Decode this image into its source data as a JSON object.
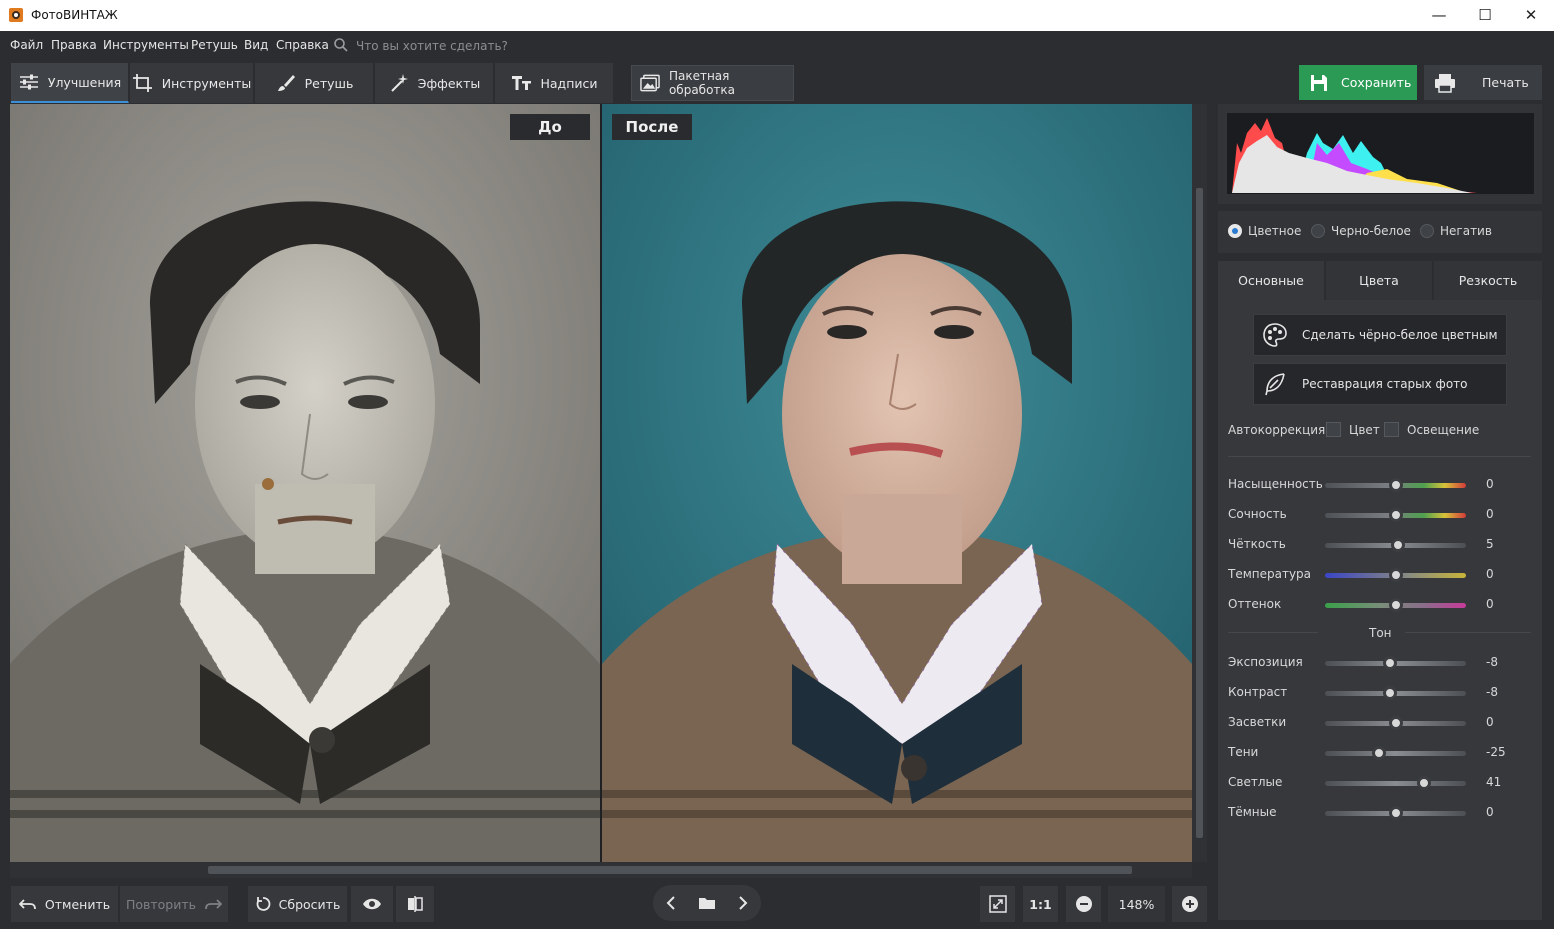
{
  "window": {
    "title": "ФотоВИНТАЖ",
    "minimize": "—",
    "maximize": "☐",
    "close": "✕"
  },
  "menu": [
    "Файл",
    "Правка",
    "Инструменты",
    "Ретушь",
    "Вид",
    "Справка"
  ],
  "search": {
    "placeholder": "Что вы хотите сделать?"
  },
  "tabs": [
    {
      "label": "Улучшения",
      "icon": "sliders-icon",
      "active": true
    },
    {
      "label": "Инструменты",
      "icon": "crop-icon",
      "active": false
    },
    {
      "label": "Ретушь",
      "icon": "brush-icon",
      "active": false
    },
    {
      "label": "Эффекты",
      "icon": "magic-wand-icon",
      "active": false
    },
    {
      "label": "Надписи",
      "icon": "text-icon",
      "active": false
    }
  ],
  "batch": {
    "label": "Пакетная обработка",
    "icon": "gallery-icon"
  },
  "actions": {
    "save": "Сохранить",
    "print": "Печать"
  },
  "compare": {
    "before": "До",
    "after": "После"
  },
  "bottom": {
    "undo": "Отменить",
    "redo": "Повторить",
    "reset": "Сбросить",
    "ratio": "1:1",
    "zoom": "148%"
  },
  "mode": {
    "options": [
      "Цветное",
      "Черно-белое",
      "Негатив"
    ],
    "selected": "Цветное"
  },
  "panel_tabs": [
    "Основные",
    "Цвета",
    "Резкость"
  ],
  "panel_active_tab": "Основные",
  "tools": {
    "colorize": "Сделать чёрно-белое цветным",
    "restore": "Реставрация старых фото"
  },
  "autocorrection": {
    "label": "Автокоррекция",
    "color": "Цвет",
    "light": "Освещение",
    "color_checked": false,
    "light_checked": false
  },
  "sliders_main": [
    {
      "label": "Насыщенность",
      "value": "0",
      "level": 0.5,
      "track": "linear-gradient(90deg,#4e5257,#7a7d82 45%,#4fa04f 70%,#d7c33a 85%,#d23a3a)"
    },
    {
      "label": "Сочность",
      "value": "0",
      "level": 0.5,
      "track": "linear-gradient(90deg,#4e5257,#7a7d82 45%,#4fa04f 70%,#d7c33a 85%,#d23a3a)"
    },
    {
      "label": "Чёткость",
      "value": "5",
      "level": 0.52,
      "track": "linear-gradient(90deg,#4c4f54,#8a8d92,#4c4f54)"
    },
    {
      "label": "Температура",
      "value": "0",
      "level": 0.5,
      "track": "linear-gradient(90deg,#3a46c8,#6a6d9a 35%,#8a8d80 60%,#c8b43a)"
    },
    {
      "label": "Оттенок",
      "value": "0",
      "level": 0.5,
      "track": "linear-gradient(90deg,#3aa04a,#7a8d7a 40%,#8a6d8a 70%,#c83a9a)"
    }
  ],
  "tone_header": "Тон",
  "sliders_tone": [
    {
      "label": "Экспозиция",
      "value": "-8",
      "level": 0.46
    },
    {
      "label": "Контраст",
      "value": "-8",
      "level": 0.46
    },
    {
      "label": "Засветки",
      "value": "0",
      "level": 0.5
    },
    {
      "label": "Тени",
      "value": "-25",
      "level": 0.38
    },
    {
      "label": "Светлые",
      "value": "41",
      "level": 0.7
    },
    {
      "label": "Тёмные",
      "value": "0",
      "level": 0.5
    }
  ],
  "colors": {
    "accent": "#3b8fd6",
    "save_green": "#2a9a55",
    "bg": "#2b2d30"
  }
}
